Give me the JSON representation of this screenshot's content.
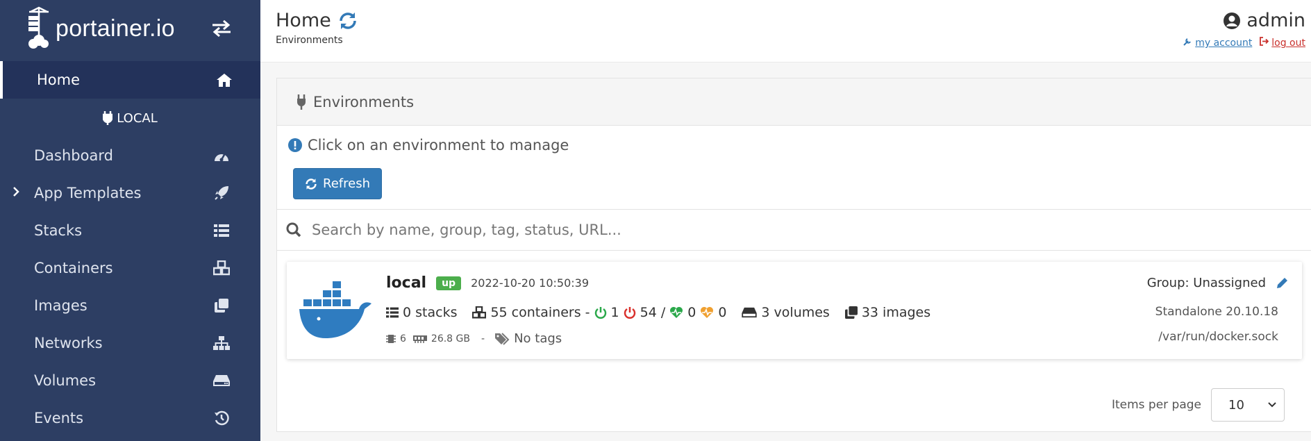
{
  "brand": {
    "name": "portainer.io"
  },
  "sidebar": {
    "home_label": "Home",
    "env_label": "LOCAL",
    "items": [
      {
        "label": "Dashboard",
        "icon": "tachometer-icon"
      },
      {
        "label": "App Templates",
        "icon": "rocket-icon"
      },
      {
        "label": "Stacks",
        "icon": "list-icon"
      },
      {
        "label": "Containers",
        "icon": "cubes-icon"
      },
      {
        "label": "Images",
        "icon": "clone-icon"
      },
      {
        "label": "Networks",
        "icon": "sitemap-icon"
      },
      {
        "label": "Volumes",
        "icon": "hdd-icon"
      },
      {
        "label": "Events",
        "icon": "history-icon"
      }
    ]
  },
  "header": {
    "title": "Home",
    "breadcrumb": "Environments",
    "user": "admin",
    "my_account": "my account",
    "log_out": "log out"
  },
  "panel": {
    "title": "Environments",
    "info": "Click on an environment to manage",
    "refresh_label": "Refresh",
    "search_placeholder": "Search by name, group, tag, status, URL..."
  },
  "environment": {
    "name": "local",
    "status": "up",
    "timestamp": "2022-10-20 10:50:39",
    "stacks": "0 stacks",
    "containers": "55 containers -",
    "running": "1",
    "stopped": "54 /",
    "healthy": "0",
    "unhealthy": "0",
    "volumes": "3 volumes",
    "images": "33 images",
    "cpu": "6",
    "memory": "26.8 GB",
    "separator": "-",
    "tags": "No tags",
    "group": "Group: Unassigned",
    "type": "Standalone 20.10.18",
    "url": "/var/run/docker.sock"
  },
  "pagination": {
    "label": "Items per page",
    "value": "10"
  },
  "colors": {
    "sidebar_bg": "#2d3e63",
    "primary": "#337ab7",
    "success": "#4cae4c",
    "running": "#2aa84a",
    "stopped": "#d9302c",
    "healthy": "#2aa84a",
    "unhealthy": "#f0a030"
  }
}
